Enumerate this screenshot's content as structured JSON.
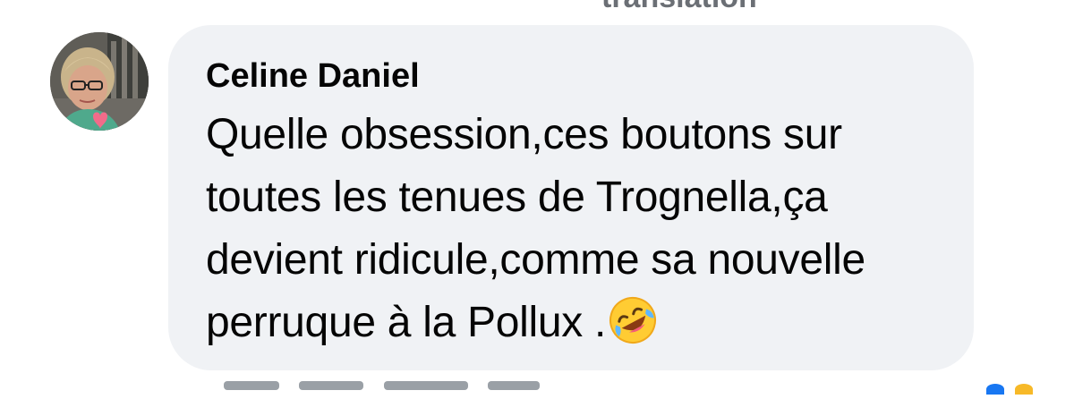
{
  "header_cutoff": {
    "label": "translation"
  },
  "comment": {
    "author": "Celine Daniel",
    "text": "Quelle obsession,ces boutons sur toutes les tenues de Trognella,ça devient ridicule,comme sa nouvelle perruque à la Pollux .",
    "trailing_emoji": "rolling-on-floor-laughing-emoji"
  },
  "avatar": {
    "icon": "user-avatar-photo"
  },
  "colors": {
    "bubble_background": "#f0f2f5",
    "text": "#050505",
    "muted_text": "#6b6f75"
  }
}
